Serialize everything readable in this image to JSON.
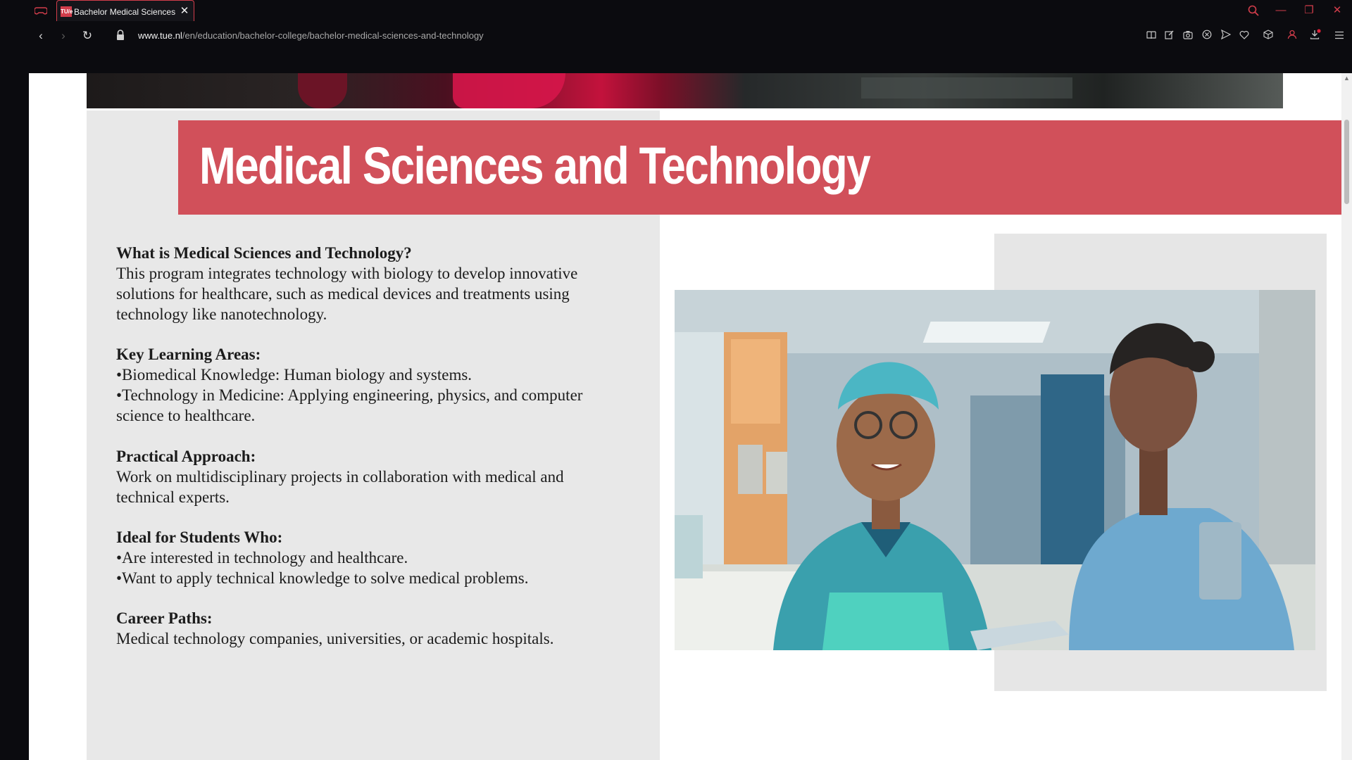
{
  "browser": {
    "tab": {
      "title": "Bachelor Medical Sciences and Technology",
      "favicon_text": "TU/e",
      "close_glyph": "✕"
    },
    "window_controls": {
      "search_glyph": "⌕",
      "minimize_glyph": "—",
      "restore_glyph": "❐",
      "close_glyph": "✕"
    },
    "nav": {
      "back_glyph": "‹",
      "forward_glyph": "›",
      "reload_glyph": "↻"
    },
    "url": {
      "domain": "www.tue.nl",
      "path": "/en/education/bachelor-college/bachelor-medical-sciences-and-technology"
    },
    "toolbar_icons": [
      "reader-view-icon",
      "edit-icon",
      "screenshot-icon",
      "blocker-icon",
      "send-icon",
      "heart-icon",
      "cube-icon",
      "profile-icon",
      "download-icon",
      "menu-icon"
    ],
    "accent_color": "#d23d4b"
  },
  "page": {
    "title": "Medical Sciences and Technology",
    "banner_color": "#d1505a",
    "sections": [
      {
        "heading": "What is Medical Sciences and Technology?",
        "lines": [
          "This program integrates technology with biology to develop innovative",
          "solutions for healthcare, such as medical devices and treatments using",
          "technology like nanotechnology."
        ]
      },
      {
        "heading": "Key Learning Areas:",
        "lines": [
          "•Biomedical Knowledge: Human biology and systems.",
          "•Technology in Medicine: Applying engineering, physics, and computer",
          "science to healthcare."
        ]
      },
      {
        "heading": "Practical Approach:",
        "lines": [
          "Work on multidisciplinary projects in collaboration with medical and",
          "technical experts."
        ]
      },
      {
        "heading": "Ideal for Students Who:",
        "lines": [
          "•Are interested in technology and healthcare.",
          "•Want to apply technical knowledge to solve medical problems."
        ]
      },
      {
        "heading": "Career Paths:",
        "lines": [
          "Medical technology companies, universities, or academic hospitals."
        ]
      }
    ]
  }
}
